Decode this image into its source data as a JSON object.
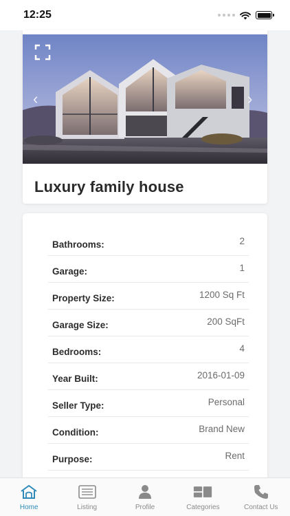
{
  "status_bar": {
    "time": "12:25"
  },
  "listing": {
    "title": "Luxury family house"
  },
  "details": [
    {
      "label": "Bathrooms:",
      "value": "2"
    },
    {
      "label": "Garage:",
      "value": "1"
    },
    {
      "label": "Property Size:",
      "value": "1200 Sq Ft"
    },
    {
      "label": "Garage Size:",
      "value": "200 SqFt"
    },
    {
      "label": "Bedrooms:",
      "value": "4"
    },
    {
      "label": "Year Built:",
      "value": "2016-01-09"
    },
    {
      "label": "Seller Type:",
      "value": "Personal"
    },
    {
      "label": "Condition:",
      "value": "Brand New"
    },
    {
      "label": "Purpose:",
      "value": "Rent"
    }
  ],
  "tab_bar": {
    "tabs": [
      {
        "label": "Home",
        "icon": "home-icon",
        "active": true
      },
      {
        "label": "Listing",
        "icon": "listing-icon",
        "active": false
      },
      {
        "label": "Profile",
        "icon": "profile-icon",
        "active": false
      },
      {
        "label": "Categories",
        "icon": "categories-icon",
        "active": false
      },
      {
        "label": "Contact Us",
        "icon": "phone-icon",
        "active": false
      }
    ]
  },
  "colors": {
    "accent": "#2d8ab8",
    "background": "#f2f3f5",
    "inactive_tab": "#8a8a8a"
  }
}
